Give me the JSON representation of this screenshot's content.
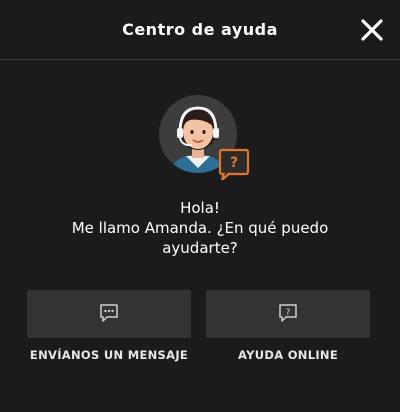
{
  "header": {
    "title": "Centro de ayuda",
    "close_icon": "close-icon"
  },
  "assistant": {
    "avatar_icon": "support-agent-avatar",
    "badge_icon": "question-chat-icon",
    "greeting_line1": "Hola!",
    "greeting_line2": "Me llamo Amanda. ¿En qué puedo",
    "greeting_line3": "ayudarte?"
  },
  "options": [
    {
      "label": "ENVÍANOS UN MENSAJE",
      "icon": "chat-message-icon"
    },
    {
      "label": "AYUDA ONLINE",
      "icon": "help-question-icon"
    }
  ],
  "colors": {
    "background": "#1b1b1b",
    "button": "#333333",
    "accent": "#e0752a"
  }
}
